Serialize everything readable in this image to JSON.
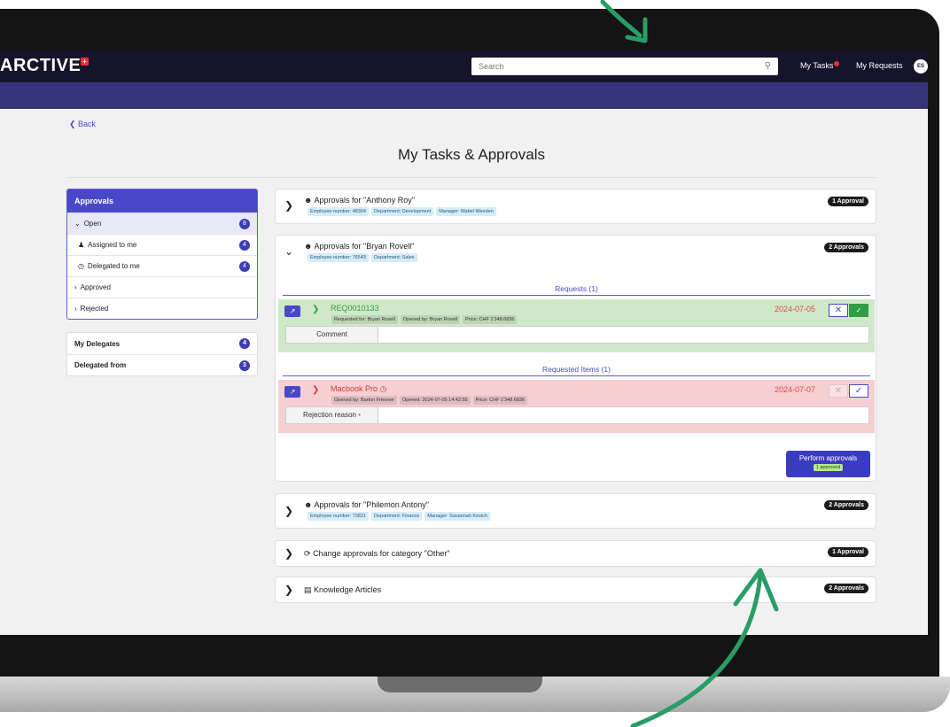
{
  "app": {
    "logo": "ARCTIVE",
    "logo_mark": "+"
  },
  "header": {
    "search_placeholder": "Search",
    "my_tasks": "My Tasks",
    "my_requests": "My Requests",
    "avatar_initials": "ES"
  },
  "page": {
    "back": "Back",
    "title": "My Tasks & Approvals"
  },
  "sidebar": {
    "heading": "Approvals",
    "open": {
      "label": "Open",
      "count": "8"
    },
    "assigned": {
      "label": "Assigned to me",
      "count": "4"
    },
    "delegated_to": {
      "label": "Delegated to me",
      "count": "4"
    },
    "approved": {
      "label": "Approved"
    },
    "rejected": {
      "label": "Rejected"
    },
    "my_delegates": {
      "label": "My Delegates",
      "count": "4"
    },
    "delegated_from": {
      "label": "Delegated from",
      "count": "3"
    }
  },
  "groups": {
    "anthony": {
      "title": "Approvals for \"Anthony Roy\"",
      "tags": [
        "Employee number: 48394",
        "Department: Development",
        "Manager: Mabel Weeden"
      ],
      "badge": "1 Approval"
    },
    "bryan": {
      "title": "Approvals for \"Bryan Rovell\"",
      "tags": [
        "Employee number: 76543",
        "Department: Sales"
      ],
      "badge": "2 Approvals",
      "requests_title": "Requests (1)",
      "request": {
        "id": "REQ0010133",
        "tags": [
          "Requested for: Bryan Rovell",
          "Opened by: Bryan Rovell",
          "Price: CHF 1'348.6836"
        ],
        "date": "2024-07-05",
        "comment_label": "Comment"
      },
      "items_title": "Requested Items (1)",
      "item": {
        "name": "Macbook Pro",
        "tags": [
          "Opened by: Barton Friesner",
          "Opened: 2024-07-05 14:42:55",
          "Price: CHF 1'348.6836"
        ],
        "date": "2024-07-07",
        "reason_label": "Rejection reason"
      },
      "perform_label": "Perform approvals",
      "perform_sub": "1 approved"
    },
    "philemon": {
      "title": "Approvals for \"Philemon Antony\"",
      "tags": [
        "Employee number: 73821",
        "Department: Finance",
        "Manager: Savannah Kesich"
      ],
      "badge": "2 Approvals"
    },
    "change": {
      "title": "Change approvals for category \"Other\"",
      "badge": "1 Approval"
    },
    "knowledge": {
      "title": "Knowledge Articles",
      "badge": "2 Approvals"
    }
  },
  "colors": {
    "topbar": "#15142b",
    "subbar": "#34347a",
    "accent": "#4848c9",
    "request_bg": "#cfe8c8",
    "rejected_bg": "#f5cfd1",
    "arrow": "#2a9d67"
  }
}
